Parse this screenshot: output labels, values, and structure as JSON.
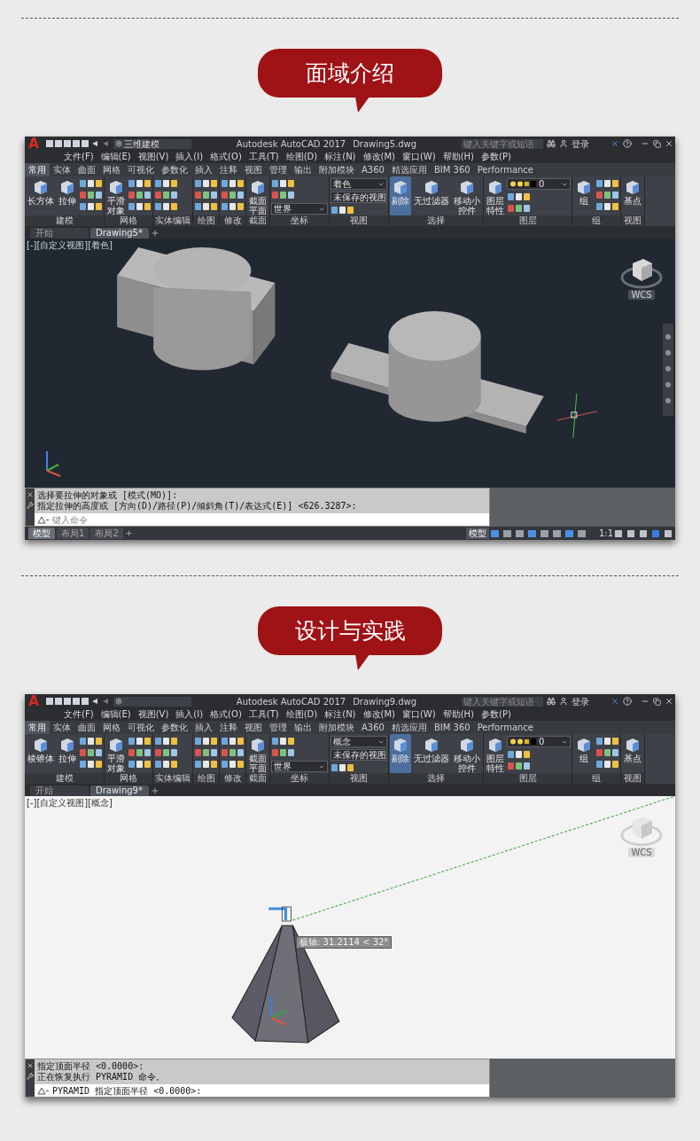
{
  "sections": [
    {
      "heading": "面域介绍",
      "window": {
        "logo": "A",
        "workspace": "三维建模",
        "app_title": "Autodesk AutoCAD 2017",
        "file_name": "Drawing5.dwg",
        "search_placeholder": "键入关键字或短语",
        "login": "登录",
        "menus": [
          "文件(F)",
          "编辑(E)",
          "视图(V)",
          "插入(I)",
          "格式(O)",
          "工具(T)",
          "绘图(D)",
          "标注(N)",
          "修改(M)",
          "窗口(W)",
          "帮助(H)",
          "参数(P)"
        ],
        "ribbon_tabs": [
          {
            "label": "常用",
            "selected": true
          },
          {
            "label": "实体",
            "selected": false
          },
          {
            "label": "曲面",
            "selected": false
          },
          {
            "label": "网格",
            "selected": false
          },
          {
            "label": "可视化",
            "selected": false
          },
          {
            "label": "参数化",
            "selected": false
          },
          {
            "label": "插入",
            "selected": false
          },
          {
            "label": "注释",
            "selected": false
          },
          {
            "label": "视图",
            "selected": false
          },
          {
            "label": "管理",
            "selected": false
          },
          {
            "label": "输出",
            "selected": false
          },
          {
            "label": "附加模块",
            "selected": false
          },
          {
            "label": "A360",
            "selected": false
          },
          {
            "label": "精选应用",
            "selected": false
          },
          {
            "label": "BIM 360",
            "selected": false
          },
          {
            "label": "Performance",
            "selected": false
          }
        ],
        "panels": [
          {
            "title": "建模",
            "items": [
              {
                "kind": "large",
                "label": "长方体",
                "on": false
              },
              {
                "kind": "large",
                "label": "拉伸",
                "on": false
              },
              {
                "kind": "tools"
              }
            ]
          },
          {
            "title": "网格",
            "items": [
              {
                "kind": "stacked",
                "label": "平滑对象",
                "on": false
              },
              {
                "kind": "tools"
              }
            ]
          },
          {
            "title": "实体编辑",
            "items": [
              {
                "kind": "tools"
              }
            ]
          },
          {
            "title": "绘图",
            "items": [
              {
                "kind": "tools"
              }
            ]
          },
          {
            "title": "修改",
            "items": [
              {
                "kind": "tools"
              }
            ]
          },
          {
            "title": "截面",
            "items": [
              {
                "kind": "stacked",
                "label": "截面平面",
                "on": false
              }
            ]
          },
          {
            "title": "坐标",
            "items": [
              {
                "kind": "tools"
              },
              {
                "kind": "dropdown",
                "value": "世界"
              }
            ]
          },
          {
            "title": "视图",
            "items": [
              {
                "kind": "dropdown",
                "value": "着色"
              },
              {
                "kind": "dropdown",
                "value": "未保存的视图"
              },
              {
                "kind": "tools"
              }
            ]
          },
          {
            "title": "选择",
            "items": [
              {
                "kind": "large",
                "label": "剔除",
                "on": true
              },
              {
                "kind": "large",
                "label": "无过滤器",
                "on": false
              },
              {
                "kind": "stacked",
                "label": "移动小控件",
                "on": false
              }
            ]
          },
          {
            "title": "图层",
            "items": [
              {
                "kind": "stacked",
                "label": "图层特性",
                "on": false
              },
              {
                "kind": "layer",
                "value": "0"
              },
              {
                "kind": "tools"
              }
            ]
          },
          {
            "title": "组",
            "items": [
              {
                "kind": "large",
                "label": "组",
                "on": false
              },
              {
                "kind": "tools"
              }
            ]
          },
          {
            "title": "视图",
            "items": [
              {
                "kind": "large",
                "label": "基点",
                "on": false
              }
            ]
          }
        ],
        "file_tabs": [
          {
            "label": "开始",
            "selected": false
          },
          {
            "label": "Drawing5*",
            "selected": true
          }
        ],
        "viewport": {
          "dark": true,
          "models": [
            {
              "kind": "keyed"
            },
            {
              "kind": "slab"
            }
          ],
          "label": "[-][自定义视图][着色]",
          "ucs_label": "WCS"
        },
        "command": {
          "history": [
            "选择要拉伸的对象或 [模式(MO)]:",
            "指定拉伸的高度或 [方向(D)/路径(P)/倾斜角(T)/表达式(E)] <626.3287>:"
          ],
          "placeholder": "键入命令"
        },
        "status_bar": {
          "layouts": [
            {
              "label": "模型",
              "selected": true
            },
            {
              "label": "布局1",
              "selected": false
            },
            {
              "label": "布局2",
              "selected": false
            }
          ],
          "mode": "模型",
          "scale": "1:1"
        }
      }
    },
    {
      "heading": "设计与实践",
      "window": {
        "logo": "A",
        "app_title": "Autodesk AutoCAD 2017",
        "file_name": "Drawing9.dwg",
        "search_placeholder": "键入关键字或短语",
        "login": "登录",
        "menus": [
          "文件(F)",
          "编辑(E)",
          "视图(V)",
          "插入(I)",
          "格式(O)",
          "工具(T)",
          "绘图(D)",
          "标注(N)",
          "修改(M)",
          "窗口(W)",
          "帮助(H)",
          "参数(P)"
        ],
        "ribbon_tabs": [
          {
            "label": "常用",
            "selected": true
          },
          {
            "label": "实体",
            "selected": false
          },
          {
            "label": "曲面",
            "selected": false
          },
          {
            "label": "网格",
            "selected": false
          },
          {
            "label": "可视化",
            "selected": false
          },
          {
            "label": "参数化",
            "selected": false
          },
          {
            "label": "插入",
            "selected": false
          },
          {
            "label": "注释",
            "selected": false
          },
          {
            "label": "视图",
            "selected": false
          },
          {
            "label": "管理",
            "selected": false
          },
          {
            "label": "输出",
            "selected": false
          },
          {
            "label": "附加模块",
            "selected": false
          },
          {
            "label": "A360",
            "selected": false
          },
          {
            "label": "精选应用",
            "selected": false
          },
          {
            "label": "BIM 360",
            "selected": false
          },
          {
            "label": "Performance",
            "selected": false
          }
        ],
        "panels": [
          {
            "title": "建模",
            "items": [
              {
                "kind": "large",
                "label": "棱锥体",
                "on": false
              },
              {
                "kind": "large",
                "label": "拉伸",
                "on": false
              },
              {
                "kind": "tools"
              }
            ]
          },
          {
            "title": "网格",
            "items": [
              {
                "kind": "stacked",
                "label": "平滑对象",
                "on": false
              },
              {
                "kind": "tools"
              }
            ]
          },
          {
            "title": "实体编辑",
            "items": [
              {
                "kind": "tools"
              }
            ]
          },
          {
            "title": "绘图",
            "items": [
              {
                "kind": "tools"
              }
            ]
          },
          {
            "title": "修改",
            "items": [
              {
                "kind": "tools"
              }
            ]
          },
          {
            "title": "截面",
            "items": [
              {
                "kind": "stacked",
                "label": "截面平面",
                "on": false
              }
            ]
          },
          {
            "title": "坐标",
            "items": [
              {
                "kind": "tools"
              },
              {
                "kind": "dropdown",
                "value": "世界"
              }
            ]
          },
          {
            "title": "视图",
            "items": [
              {
                "kind": "dropdown",
                "value": "概念"
              },
              {
                "kind": "dropdown",
                "value": "未保存的视图"
              },
              {
                "kind": "tools"
              }
            ]
          },
          {
            "title": "选择",
            "items": [
              {
                "kind": "large",
                "label": "剔除",
                "on": true
              },
              {
                "kind": "large",
                "label": "无过滤器",
                "on": false
              },
              {
                "kind": "stacked",
                "label": "移动小控件",
                "on": false
              }
            ]
          },
          {
            "title": "图层",
            "items": [
              {
                "kind": "stacked",
                "label": "图层特性",
                "on": false
              },
              {
                "kind": "layer",
                "value": "0"
              },
              {
                "kind": "tools"
              }
            ]
          },
          {
            "title": "组",
            "items": [
              {
                "kind": "large",
                "label": "组",
                "on": false
              },
              {
                "kind": "tools"
              }
            ]
          },
          {
            "title": "视图",
            "items": [
              {
                "kind": "large",
                "label": "基点",
                "on": false
              }
            ]
          }
        ],
        "file_tabs": [
          {
            "label": "开始",
            "selected": false
          },
          {
            "label": "Drawing9*",
            "selected": true
          }
        ],
        "viewport": {
          "dark": false,
          "models": [
            {
              "kind": "pyramid"
            }
          ],
          "label": "[-][自定义视图][概念]",
          "ucs_label": "WCS",
          "tooltip": "极轴: 31.2114 < 32°"
        },
        "command": {
          "history": [
            "指定顶面半径 <0.0000>:",
            "正在恢复执行 PYRAMID 命令。"
          ],
          "value": "PYRAMID 指定顶面半径 <0.0000>:"
        }
      }
    }
  ]
}
